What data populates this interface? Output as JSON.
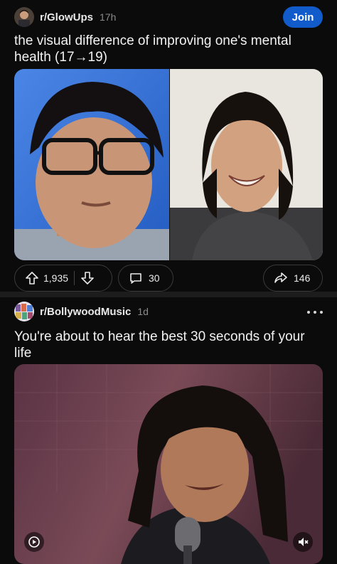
{
  "post1": {
    "subreddit": "r/GlowUps",
    "age": "17h",
    "join_label": "Join",
    "title": "the visual difference of improving one's mental health (17→19)",
    "upvotes": "1,935",
    "comments": "30",
    "shares": "146"
  },
  "post2": {
    "subreddit": "r/BollywoodMusic",
    "age": "1d",
    "title": "You're about to hear the best 30 seconds of your life"
  },
  "colors": {
    "background": "#0b0b0b",
    "join_button": "#115bca",
    "pill_border": "#3a3a3a",
    "muted_text": "#8b8b8b"
  },
  "icons": [
    "upvote-icon",
    "downvote-icon",
    "comment-icon",
    "share-icon",
    "more-options-icon",
    "video-reel-icon",
    "mute-icon"
  ]
}
